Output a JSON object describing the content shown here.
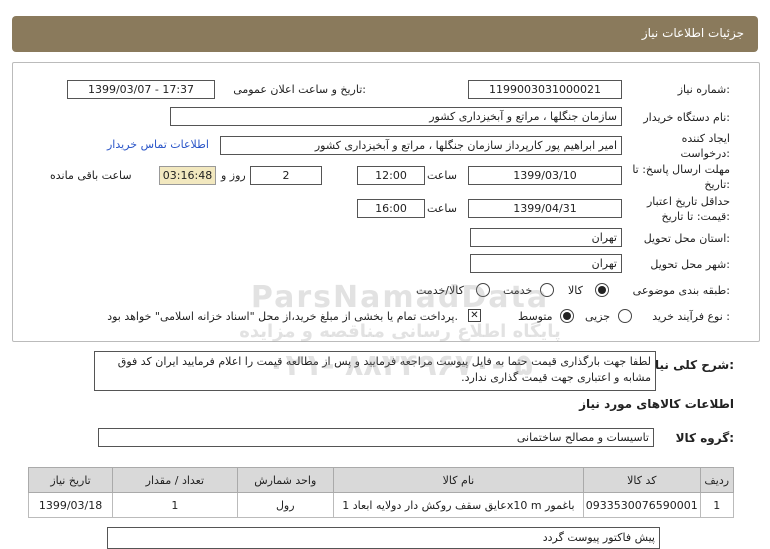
{
  "title": "جزئیات اطلاعات نیاز",
  "fields": {
    "need_number_label": "شماره نیاز:",
    "need_number": "1199003031000021",
    "announce_label": "تاریخ و ساعت اعلان عمومی:",
    "announce_value": "1399/03/07 - 17:37",
    "buyer_org_label": "نام دستگاه خریدار:",
    "buyer_org": "سازمان جنگلها ، مراتع و آبخیزداری کشور",
    "creator_label": "ایجاد کننده درخواست:",
    "creator": "امیر  ابراهیم پور کارپرداز سازمان جنگلها ، مراتع و آبخیزداری کشور",
    "contact_link": "اطلاعات تماس خریدار",
    "deadline_label": "مهلت ارسال پاسخ: تا تاریخ:",
    "deadline_date": "1399/03/10",
    "time_label": "ساعت",
    "deadline_time": "12:00",
    "days_value": "2",
    "days_label": "روز و",
    "timer": "03:16:48",
    "remaining_label": "ساعت باقی مانده",
    "validity_label": "حداقل تاریخ اعتبار قیمت: تا تاریخ:",
    "validity_date": "1399/04/31",
    "validity_time": "16:00",
    "province_label": "استان محل تحویل:",
    "province": "تهران",
    "city_label": "شهر محل تحویل:",
    "city": "تهران",
    "category_label": "طبقه بندی موضوعی:",
    "cat_goods": "کالا",
    "cat_service": "خدمت",
    "cat_both": "کالا/خدمت",
    "process_label": "نوع فرآیند خرید :",
    "proc_partial": "جزیی",
    "proc_medium": "متوسط",
    "payment_note": "پرداخت تمام یا بخشی از مبلغ خرید،از محل \"اسناد خزانه اسلامی\" خواهد بود."
  },
  "description": {
    "label": "شرح کلی نیاز:",
    "text": "لطفا جهت بارگذاری قیمت حتما به فایل پیوست مراجعه فرمایید و پس از مطالعه قیمت را اعلام فرمایید ایران کد فوق مشابه و اعتباری جهت قیمت گذاری ندارد."
  },
  "goods_info_title": "اطلاعات کالاهای مورد نیاز",
  "goods_group_label": "گروه کالا:",
  "goods_group": "تاسیسات و مصالح ساختمانی",
  "table": {
    "headers": [
      "ردیف",
      "کد کالا",
      "نام کالا",
      "واحد شمارش",
      "تعداد / مقدار",
      "تاریخ نیاز"
    ],
    "rows": [
      [
        "1",
        "093353007659000‌1",
        "عایق سقف روکش دار دولایه ابعاد 1x10 m باغمور",
        "رول",
        "1",
        "1399/03/18"
      ]
    ]
  },
  "bottom_note": "پیش فاکتور پیوست گردد",
  "watermark": {
    "line1": "ParsNamadData",
    "line2": "پایگاه اطلاع رسانی مناقصه و مزایده",
    "line3": "۰۲۱- ۸۸۳۴۹۶۷۰- ۵"
  },
  "colors": {
    "titlebar": "#8a7a5c",
    "timer_bg": "#f2e8bf",
    "link": "#2a55c8"
  }
}
